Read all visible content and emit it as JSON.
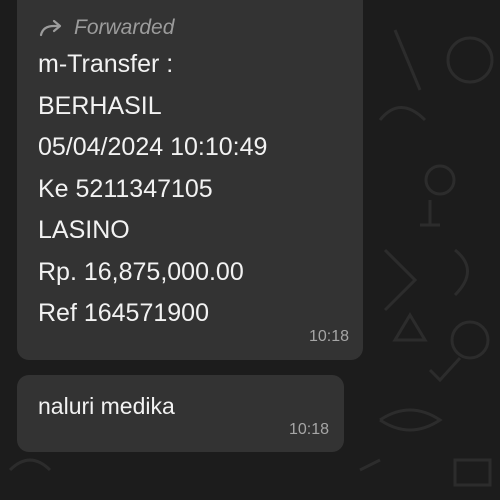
{
  "messages": [
    {
      "forwarded_label": "Forwarded",
      "lines": [
        "m-Transfer :",
        "BERHASIL",
        "05/04/2024 10:10:49",
        "Ke 5211347105",
        "LASINO",
        "Rp. 16,875,000.00",
        "Ref 164571900"
      ],
      "time": "10:18"
    },
    {
      "text": "naluri medika",
      "time": "10:18"
    }
  ],
  "icons": {
    "forward": "forward-arrow-icon"
  },
  "colors": {
    "background": "#1c1c1c",
    "bubble": "#333333",
    "text": "#f2f2f2",
    "meta": "#a6a6a6"
  }
}
